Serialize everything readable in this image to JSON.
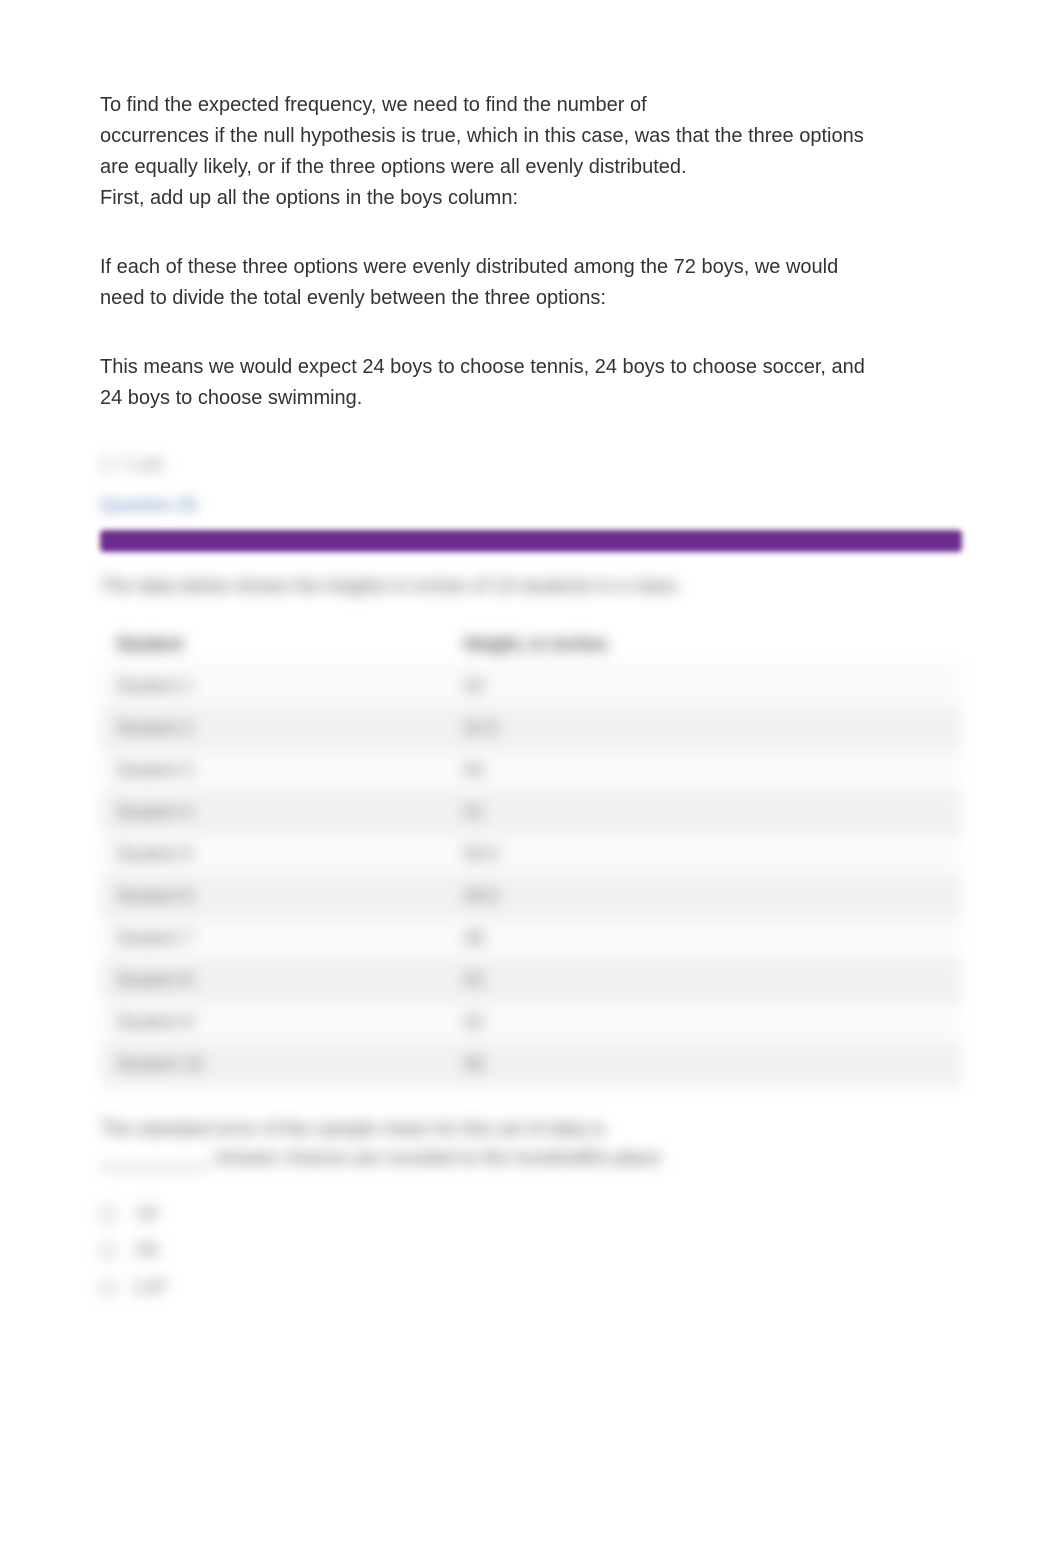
{
  "explanation": {
    "p1_l1": "To find the expected frequency, we need to find the number of",
    "p1_l2": "occurrences if the null hypothesis is true, which in this case, was that the three options",
    "p1_l3": "are equally likely, or if the three options were all evenly distributed.",
    "p1_l4": "First, add up all the options in the boys column:",
    "p2_l1": "If each of these three options were evenly distributed among the 72 boys, we would",
    "p2_l2": "need to divide the total evenly between the three options:",
    "p3_l1": "This means we would expect 24 boys to choose tennis, 24 boys to choose soccer, and",
    "p3_l2": "24 boys to choose swimming."
  },
  "obscured": {
    "points_line": "1 / 1 pts",
    "question_link": "Question 20"
  },
  "question": {
    "intro": "The data below shows the heights in inches of 10 students in a class.",
    "table": {
      "headers": [
        "Student",
        "Height, in inches"
      ],
      "rows": [
        [
          "Student 1",
          "53"
        ],
        [
          "Student 2",
          "52.5"
        ],
        [
          "Student 3",
          "54"
        ],
        [
          "Student 4",
          "51"
        ],
        [
          "Student 5",
          "50.5"
        ],
        [
          "Student 6",
          "49.5"
        ],
        [
          "Student 7",
          "48"
        ],
        [
          "Student 8",
          "53"
        ],
        [
          "Student 9",
          "52"
        ],
        [
          "Student 10",
          "50"
        ]
      ]
    },
    "prompt_l1": "The standard error of the sample mean for this set of data is",
    "prompt_l2": "__________. Answer choices are rounded to the hundredths place.",
    "options": [
      ".19",
      ".59",
      "1.87"
    ]
  }
}
